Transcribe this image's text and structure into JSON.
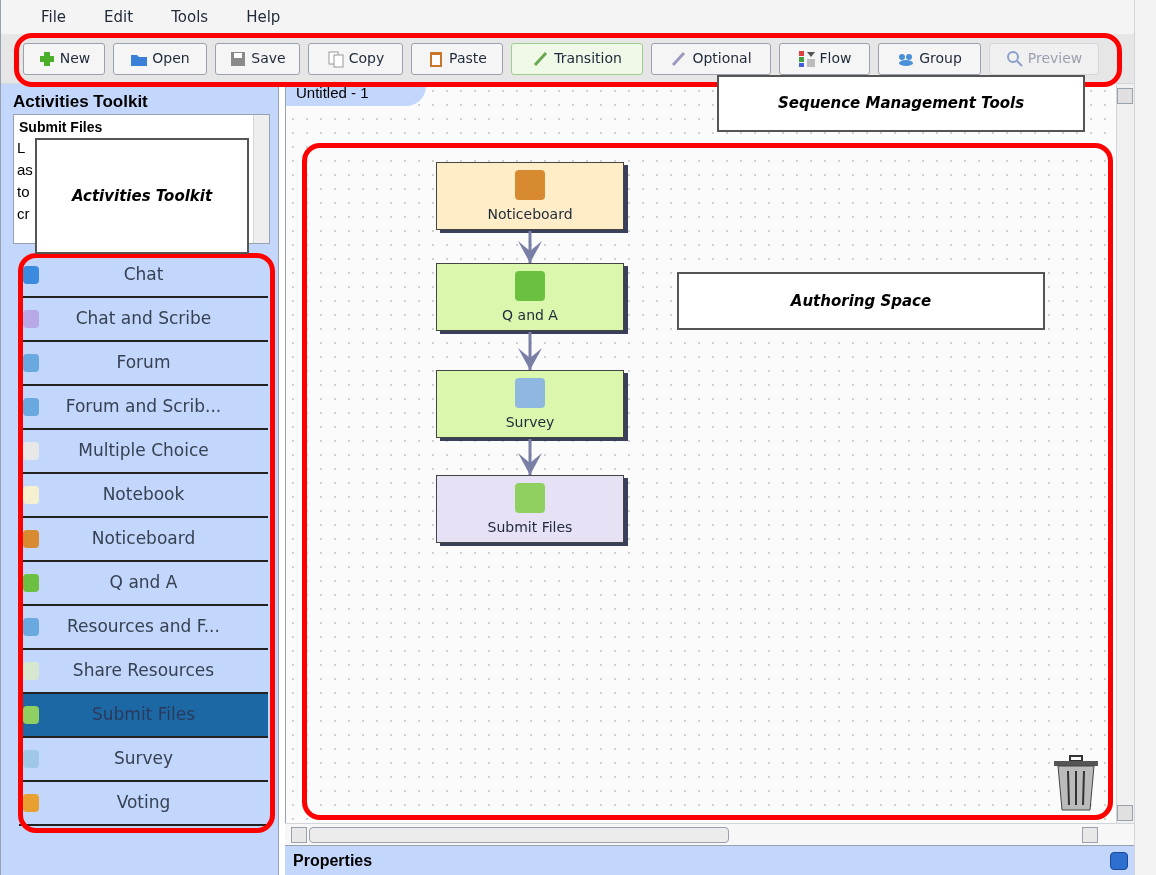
{
  "menu": [
    "File",
    "Edit",
    "Tools",
    "Help"
  ],
  "toolbar": [
    {
      "label": "New",
      "disabled": false,
      "selected": false
    },
    {
      "label": "Open",
      "disabled": false,
      "selected": false
    },
    {
      "label": "Save",
      "disabled": false,
      "selected": false
    },
    {
      "label": "Copy",
      "disabled": false,
      "selected": false
    },
    {
      "label": "Paste",
      "disabled": false,
      "selected": false
    },
    {
      "label": "Transition",
      "disabled": false,
      "selected": true
    },
    {
      "label": "Optional",
      "disabled": false,
      "selected": false
    },
    {
      "label": "Flow",
      "disabled": false,
      "selected": false
    },
    {
      "label": "Group",
      "disabled": false,
      "selected": false
    },
    {
      "label": "Preview",
      "disabled": true,
      "selected": false
    }
  ],
  "toolkit": {
    "title": "Activities Toolkit",
    "description_title": "Submit Files",
    "description_lines": [
      "L",
      "as",
      "to",
      "cr"
    ],
    "activities": [
      {
        "label": "Chat",
        "selected": false
      },
      {
        "label": "Chat and Scribe",
        "selected": false
      },
      {
        "label": "Forum",
        "selected": false
      },
      {
        "label": "Forum and Scrib...",
        "selected": false
      },
      {
        "label": "Multiple Choice",
        "selected": false
      },
      {
        "label": "Notebook",
        "selected": false
      },
      {
        "label": "Noticeboard",
        "selected": false
      },
      {
        "label": "Q and A",
        "selected": false
      },
      {
        "label": "Resources and F...",
        "selected": false
      },
      {
        "label": "Share Resources",
        "selected": false
      },
      {
        "label": "Submit Files",
        "selected": true
      },
      {
        "label": "Survey",
        "selected": false
      },
      {
        "label": "Voting",
        "selected": false
      }
    ]
  },
  "canvas": {
    "tab": "Untitled - 1",
    "nodes": [
      {
        "label": "Noticeboard",
        "color": "#ffedc8"
      },
      {
        "label": "Q and A",
        "color": "#dbf7ae"
      },
      {
        "label": "Survey",
        "color": "#dbf7ae"
      },
      {
        "label": "Submit Files",
        "color": "#e6e1f4"
      }
    ]
  },
  "callouts": [
    "Sequence Management Tools",
    "Activities Toolkit",
    "Authoring Space"
  ],
  "properties": {
    "title": "Properties"
  }
}
